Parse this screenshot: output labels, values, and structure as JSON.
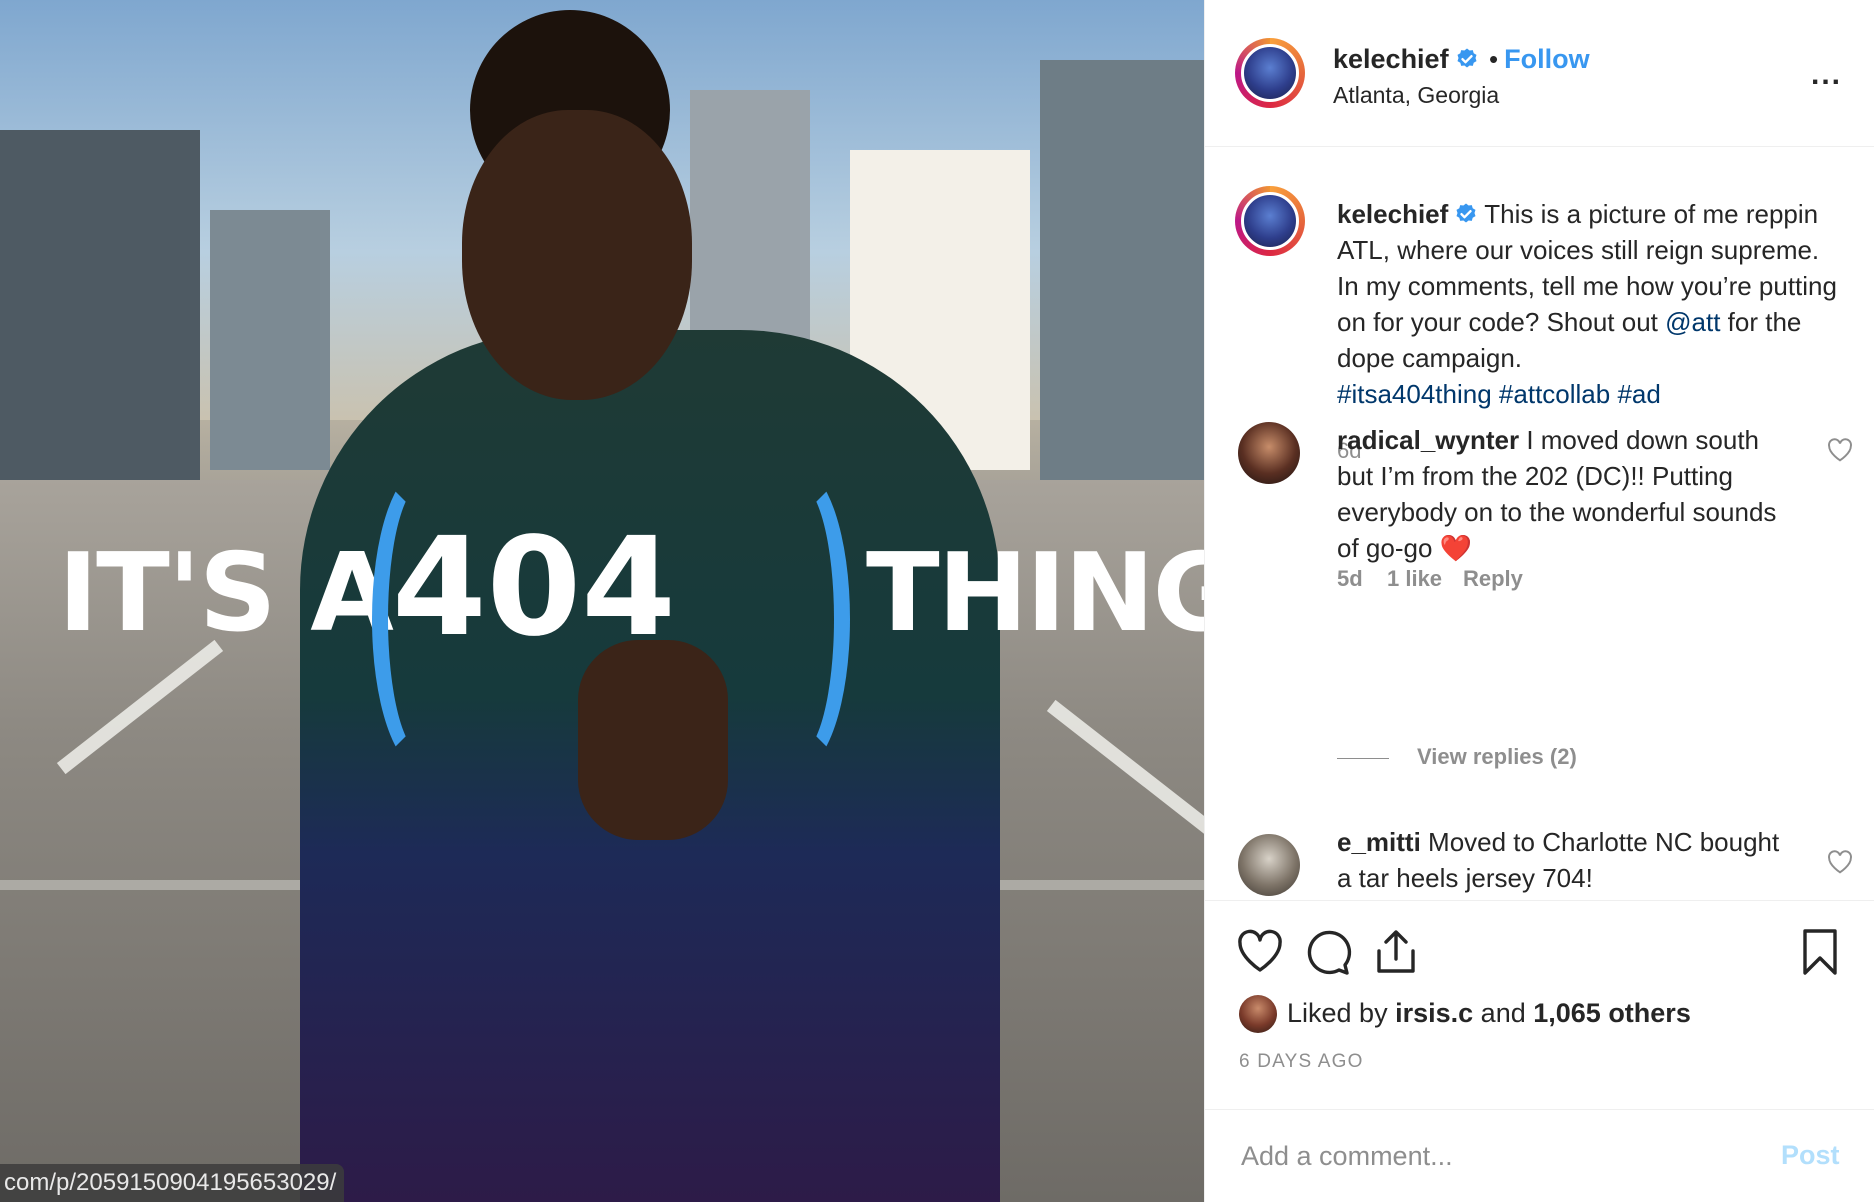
{
  "post": {
    "image_text": {
      "left": "IT'S A",
      "number": "404",
      "right": "THING"
    },
    "url_overlay": "com/p/2059150904195653029/"
  },
  "header": {
    "username": "kelechief",
    "verified_icon": "verified-badge-icon",
    "separator": "•",
    "follow_label": "Follow",
    "location": "Atlanta, Georgia",
    "more_label": "..."
  },
  "caption": {
    "username": "kelechief",
    "text_1": "This is a picture of me reppin ATL, where our voices still reign supreme. In my comments, tell me how you’re putting on for your code? Shout out ",
    "mention": "@att",
    "text_2": " for the dope campaign.",
    "hashtags": [
      "#itsa404thing",
      "#attcollab",
      "#ad"
    ],
    "age": "6d"
  },
  "comments": [
    {
      "username": "radical_wynter",
      "text": "I moved down south but I’m from the 202 (DC)!! Putting everybody on to the wonderful sounds of go-go",
      "emoji": "❤️",
      "age": "5d",
      "likes": "1 like",
      "reply_label": "Reply",
      "view_replies": "View replies (2)"
    },
    {
      "username": "e_mitti",
      "text": "Moved to Charlotte NC bought a tar heels jersey 704!"
    }
  ],
  "actions": {
    "icons": [
      "heart-icon",
      "comment-icon",
      "share-icon",
      "bookmark-icon"
    ],
    "liked_prefix": "Liked by",
    "liked_user": "irsis.c",
    "liked_and": "and",
    "liked_count": "1,065 others",
    "date": "6 DAYS AGO"
  },
  "add_comment": {
    "placeholder": "Add a comment...",
    "post_label": "Post"
  },
  "colors": {
    "accent": "#3897f0",
    "verified": "#3897f0",
    "heart": "#ed4956",
    "muted": "#8e8e8e"
  }
}
